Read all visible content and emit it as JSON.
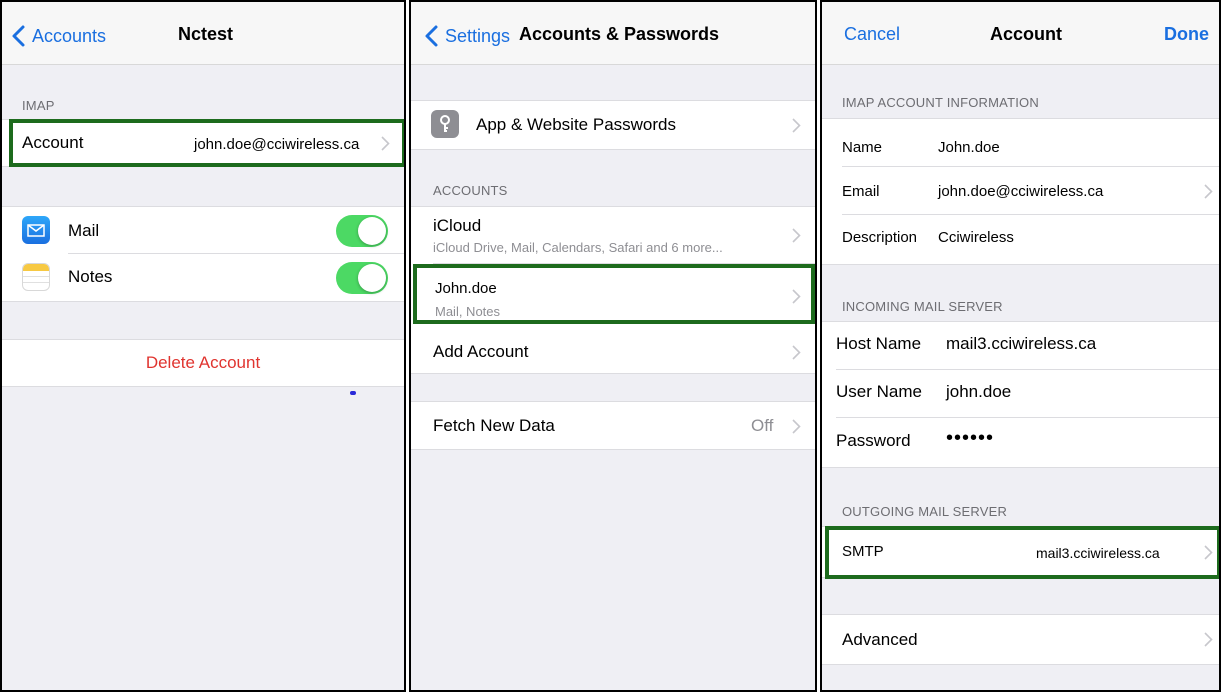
{
  "panel1": {
    "back_label": "Accounts",
    "title": "Nctest",
    "section_imap": "IMAP",
    "account_label": "Account",
    "account_value": "john.doe@cciwireless.ca",
    "mail_label": "Mail",
    "mail_toggle": true,
    "notes_label": "Notes",
    "notes_toggle": true,
    "delete_label": "Delete Account"
  },
  "panel2": {
    "back_label": "Settings",
    "title": "Accounts & Passwords",
    "app_passwords_label": "App & Website Passwords",
    "section_accounts": "ACCOUNTS",
    "icloud_label": "iCloud",
    "icloud_sub": "iCloud Drive, Mail, Calendars, Safari and 6 more...",
    "johndoe_label": "John.doe",
    "johndoe_sub": "Mail, Notes",
    "add_account_label": "Add Account",
    "fetch_label": "Fetch New Data",
    "fetch_value": "Off"
  },
  "panel3": {
    "cancel_label": "Cancel",
    "title": "Account",
    "done_label": "Done",
    "section_imap_info": "IMAP ACCOUNT INFORMATION",
    "name_label": "Name",
    "name_value": "John.doe",
    "email_label": "Email",
    "email_value": "john.doe@cciwireless.ca",
    "description_label": "Description",
    "description_value": "Cciwireless",
    "section_incoming": "INCOMING MAIL SERVER",
    "hostname_label": "Host Name",
    "hostname_value": "mail3.cciwireless.ca",
    "username_label": "User Name",
    "username_value": "john.doe",
    "password_label": "Password",
    "password_value": "••••••",
    "section_outgoing": "OUTGOING MAIL SERVER",
    "smtp_label": "SMTP",
    "smtp_value": "mail3.cciwireless.ca",
    "advanced_label": "Advanced"
  },
  "colors": {
    "accent": "#1a6fe0",
    "toggle_on": "#4cd964",
    "destructive": "#e0342f",
    "highlight_border": "#1d6b1d"
  }
}
